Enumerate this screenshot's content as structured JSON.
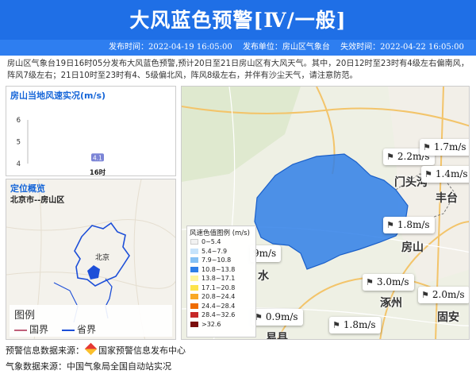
{
  "header": {
    "title": "大风蓝色预警[Ⅳ/一般]",
    "publish_time": "发布时间：2022-04-19 16:05:00",
    "publisher": "发布单位：房山区气象台",
    "expire_time": "失效时间：2022-04-22 16:05:00"
  },
  "description": "房山区气象台19日16时05分发布大风蓝色预警,预计20日至21日房山区有大风天气。其中，20日12时至23时有4级左右偏南风，阵风7级左右；21日10时至23时有4、5级偏北风，阵风8级左右，并伴有沙尘天气，请注意防范。",
  "wind_chart": {
    "title": "房山当地风速实况(m/s)"
  },
  "chart_data": {
    "type": "scatter",
    "title": "房山当地风速实况(m/s)",
    "categories": [
      "16时"
    ],
    "values": [
      4.1
    ],
    "ylim": [
      4,
      6
    ],
    "yticks": [
      4,
      5,
      6
    ],
    "tick_labels": [
      "4",
      "5",
      "6"
    ],
    "data_labels": [
      "4.1"
    ]
  },
  "location": {
    "title": "定位概览",
    "subtitle": "北京市--房山区",
    "label_beijing": "北京",
    "legend_title": "图例",
    "legend_items": [
      {
        "label": "国界",
        "color": "#c0607a"
      },
      {
        "label": "省界",
        "color": "#1d4fd8"
      }
    ]
  },
  "map": {
    "wind_labels": [
      {
        "value": "2.2m/s"
      },
      {
        "value": "1.7m/s"
      },
      {
        "value": "1.4m/s"
      },
      {
        "value": "1.8m/s"
      },
      {
        "value": "9m/s"
      },
      {
        "value": "3.0m/s"
      },
      {
        "value": "2.0m/s"
      },
      {
        "value": "0.9m/s"
      },
      {
        "value": "1.8m/s"
      }
    ],
    "place_names": [
      "门头沟",
      "丰台",
      "房山",
      "涿州",
      "固安",
      "水",
      "易县"
    ],
    "legend": {
      "title": "风速色值图例 (m/s)",
      "items": [
        {
          "label": "0~5.4",
          "color": "#f2f2f2"
        },
        {
          "label": "5.4~7.9",
          "color": "#c6e3fb"
        },
        {
          "label": "7.9~10.8",
          "color": "#86c1f4"
        },
        {
          "label": "10.8~13.8",
          "color": "#2f7fe8"
        },
        {
          "label": "13.8~17.1",
          "color": "#fff59d"
        },
        {
          "label": "17.1~20.8",
          "color": "#fde34a"
        },
        {
          "label": "20.8~24.4",
          "color": "#f9a825"
        },
        {
          "label": "24.4~28.4",
          "color": "#ef6c00"
        },
        {
          "label": "28.4~32.6",
          "color": "#c62828"
        },
        {
          "label": ">32.6",
          "color": "#7b0d0d"
        }
      ]
    }
  },
  "footer": {
    "warning_source": "预警信息数据来源：",
    "warning_source_name": "国家预警信息发布中心",
    "weather_source": "气象数据来源：中国气象局全国自动站实况"
  },
  "colors": {
    "header_blue": "#1f6fe6",
    "meta_blue": "#2e7ef0",
    "accent_blue": "#1565d8",
    "district_fill": "#2f7fe8"
  }
}
